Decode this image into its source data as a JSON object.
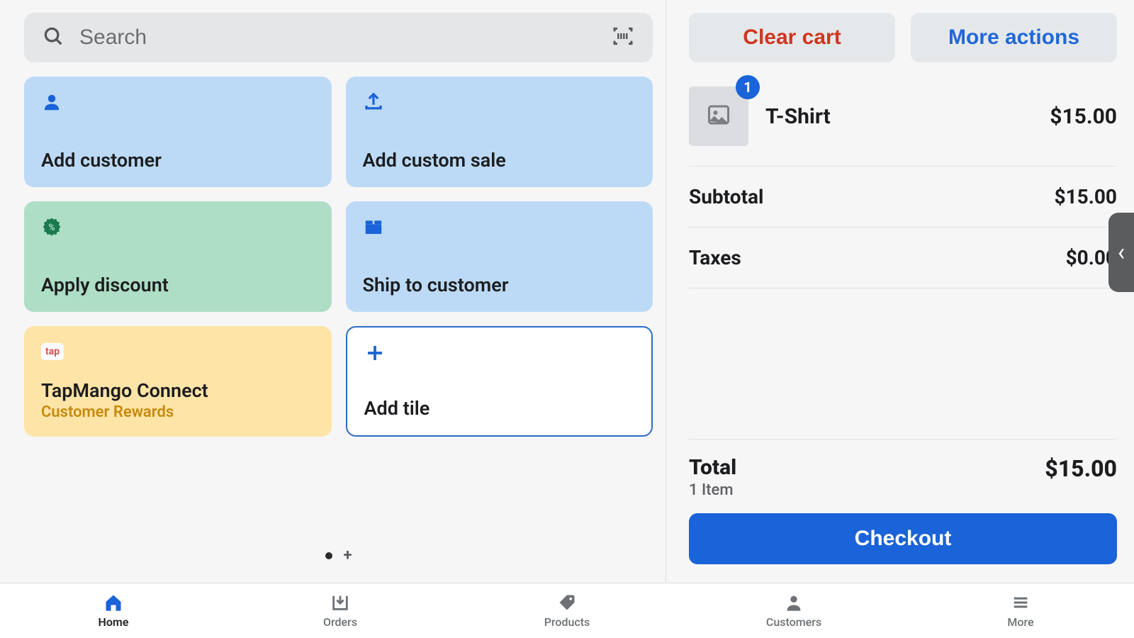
{
  "search": {
    "placeholder": "Search"
  },
  "tiles": {
    "add_customer": "Add customer",
    "add_custom_sale": "Add custom sale",
    "apply_discount": "Apply discount",
    "ship_to_customer": "Ship to customer",
    "tapmango_title": "TapMango Connect",
    "tapmango_subtitle": "Customer Rewards",
    "tapmango_logo_text": "tap",
    "add_tile": "Add tile"
  },
  "cart": {
    "clear_label": "Clear cart",
    "more_actions_label": "More actions",
    "items": [
      {
        "qty": "1",
        "name": "T-Shirt",
        "price": "$15.00"
      }
    ],
    "subtotal_label": "Subtotal",
    "subtotal_value": "$15.00",
    "taxes_label": "Taxes",
    "taxes_value": "$0.00",
    "total_label": "Total",
    "total_sub": "1 Item",
    "total_value": "$15.00",
    "checkout_label": "Checkout"
  },
  "nav": {
    "home": "Home",
    "orders": "Orders",
    "products": "Products",
    "customers": "Customers",
    "more": "More"
  }
}
